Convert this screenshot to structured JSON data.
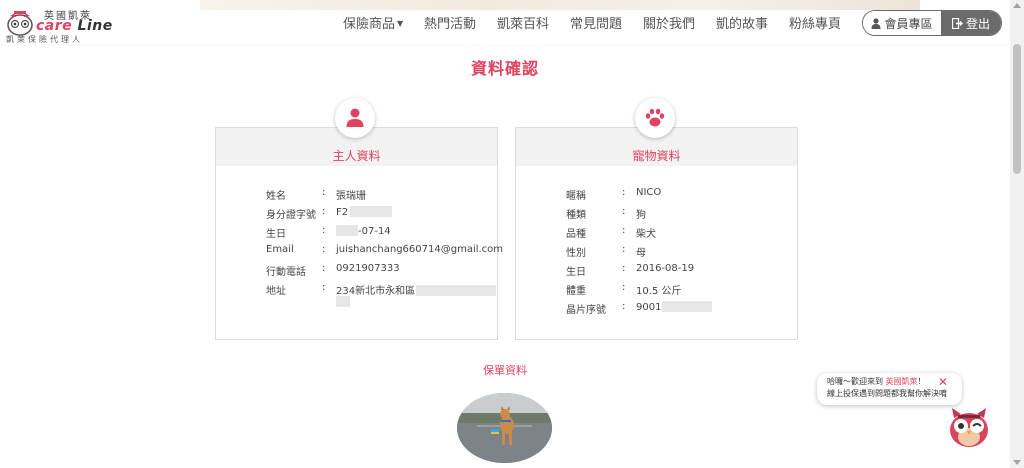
{
  "brand": {
    "name_cn": "英國凱萊",
    "name_en_left": "care",
    "name_en_right": "Line",
    "subtitle": "凱萊保險代理人"
  },
  "nav": {
    "items": [
      {
        "label": "保險商品",
        "dropdown": true
      },
      {
        "label": "熱門活動"
      },
      {
        "label": "凱萊百科"
      },
      {
        "label": "常見問題"
      },
      {
        "label": "關於我們"
      },
      {
        "label": "凱的故事"
      },
      {
        "label": "粉絲專頁"
      }
    ],
    "member_label": "會員專區",
    "logout_label": "登出"
  },
  "page": {
    "title": "資料確認"
  },
  "owner": {
    "title": "主人資料",
    "fields": [
      {
        "key": "姓名",
        "value": "張瑞珊"
      },
      {
        "key": "身分證字號",
        "value": "F2"
      },
      {
        "key": "生日",
        "value": "-07-14"
      },
      {
        "key": "Email",
        "value": "juishanchang660714@gmail.com"
      },
      {
        "key": "行動電話",
        "value": "0921907333"
      },
      {
        "key": "地址",
        "value": "234新北市永和區"
      }
    ]
  },
  "pet": {
    "title": "寵物資料",
    "fields": [
      {
        "key": "暱稱",
        "value": "NICO"
      },
      {
        "key": "種類",
        "value": "狗"
      },
      {
        "key": "品種",
        "value": "柴犬"
      },
      {
        "key": "性別",
        "value": "母"
      },
      {
        "key": "生日",
        "value": "2016-08-19"
      },
      {
        "key": "體重",
        "value": "10.5 公斤"
      },
      {
        "key": "晶片序號",
        "value": "9001"
      }
    ]
  },
  "policy": {
    "title": "保單資料"
  },
  "chat": {
    "line1_prefix": "哈囉～歡迎來到",
    "line1_brand": "英國凱萊",
    "line1_suffix": "！",
    "line2": "線上投保遇到問題都我幫你解決唷",
    "close_symbol": "✕"
  },
  "colors": {
    "accent": "#e0435f",
    "header_button": "#6b6b6b",
    "card_head": "#f2f2f2"
  },
  "icons": {
    "owner_badge": "person-icon",
    "pet_badge": "paw-icon",
    "member": "user-icon",
    "logout": "sign-out-icon"
  }
}
